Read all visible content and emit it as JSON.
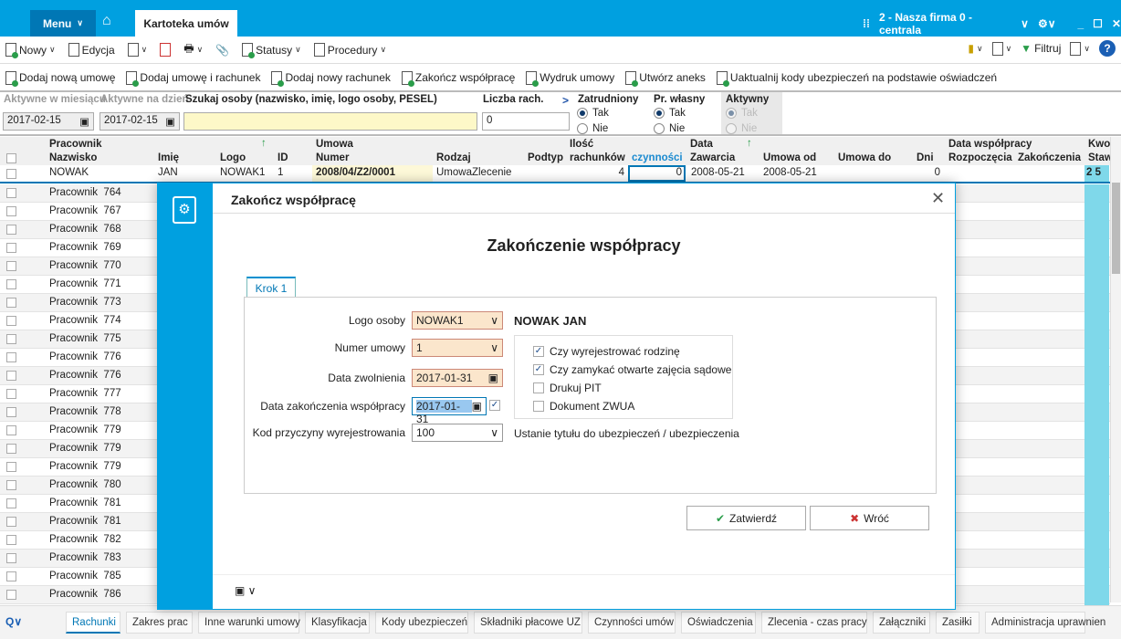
{
  "topbar": {
    "menu": "Menu",
    "tab": "Kartoteka umów",
    "firm": "2 - Nasza firma 0 - centrala"
  },
  "toolbar": {
    "nowy": "Nowy",
    "edycja": "Edycja",
    "statusy": "Statusy",
    "procedury": "Procedury",
    "filtruj": "Filtruj"
  },
  "actions": [
    "Dodaj nową umowę",
    "Dodaj umowę i rachunek",
    "Dodaj nowy rachunek",
    "Zakończ współpracę",
    "Wydruk umowy",
    "Utwórz aneks",
    "Uaktualnij kody ubezpieczeń na podstawie oświadczeń"
  ],
  "filters": {
    "aktywne_miesiac_label": "Aktywne w miesiącu",
    "aktywne_miesiac": "2017-02-15",
    "aktywne_dzien_label": "Aktywne na dzień",
    "aktywne_dzien": "2017-02-15",
    "szukaj_label": "Szukaj osoby (nazwisko, imię, logo osoby, PESEL)",
    "szukaj": "",
    "liczba_label": "Liczba rach.",
    "liczba": "0",
    "zatrudniony_label": "Zatrudniony",
    "wlasny_label": "Pr. własny",
    "aktywny_label": "Aktywny",
    "tak": "Tak",
    "nie": "Nie"
  },
  "grid": {
    "groups": {
      "pracownik": "Pracownik",
      "umowa": "Umowa",
      "ilosc": "Ilość",
      "data": "Data",
      "data_wsp": "Data współpracy",
      "kwota": "Kwo"
    },
    "columns": [
      "Nazwisko",
      "Imię",
      "Logo",
      "ID",
      "Numer",
      "Rodzaj",
      "Podtyp",
      "rachunków",
      "czynności",
      "Zawarcia",
      "Umowa od",
      "Umowa do",
      "Dni",
      "Rozpoczęcia",
      "Zakończenia",
      "Staw"
    ],
    "first_row": {
      "nazwisko": "NOWAK",
      "imie": "JAN",
      "logo": "NOWAK1",
      "id": "1",
      "numer": "2008/04/Z2/0001",
      "rodzaj": "UmowaZlecenie",
      "rachunkow": "4",
      "czynnosci": "0",
      "zawarcia": "2008-05-21",
      "umowa_od": "2008-05-21",
      "dni": "0",
      "stawka": "2 5"
    },
    "rows": [
      "Pracownik  764",
      "Pracownik  767",
      "Pracownik  768",
      "Pracownik  769",
      "Pracownik  770",
      "Pracownik  771",
      "Pracownik  773",
      "Pracownik  774",
      "Pracownik  775",
      "Pracownik  776",
      "Pracownik  776",
      "Pracownik  777",
      "Pracownik  778",
      "Pracownik  779",
      "Pracownik  779",
      "Pracownik  779",
      "Pracownik  780",
      "Pracownik  781",
      "Pracownik  781",
      "Pracownik  782",
      "Pracownik  783",
      "Pracownik  785",
      "Pracownik  786"
    ]
  },
  "bottom_tabs": [
    "Rachunki",
    "Zakres prac",
    "Inne warunki umowy",
    "Klasyfikacja",
    "Kody ubezpieczeń",
    "Składniki płacowe UZ",
    "Czynności umów",
    "Oświadczenia",
    "Zlecenia - czas pracy",
    "Załączniki",
    "Zasiłki",
    "Administracja uprawnien"
  ],
  "dialog": {
    "title": "Zakończ współpracę",
    "heading": "Zakończenie współpracy",
    "step": "Krok 1",
    "logo_label": "Logo osoby",
    "logo": "NOWAK1",
    "person": "NOWAK JAN",
    "numer_label": "Numer umowy",
    "numer": "1",
    "zwolnienie_label": "Data zwolnienia",
    "zwolnienie": "2017-01-31",
    "zakonczenie_label": "Data zakończenia współpracy",
    "zakonczenie": "2017-01-31",
    "kod_label": "Kod przyczyny wyrejestrowania",
    "kod": "100",
    "kod_desc": "Ustanie tytułu do ubezpieczeń / ubezpieczenia",
    "checks": [
      {
        "label": "Czy wyrejestrować rodzinę",
        "checked": true
      },
      {
        "label": "Czy zamykać otwarte zajęcia sądowe",
        "checked": true
      },
      {
        "label": "Drukuj PIT",
        "checked": false
      },
      {
        "label": "Dokument ZWUA",
        "checked": false
      }
    ],
    "ok": "Zatwierdź",
    "back": "Wróć"
  },
  "colors": {
    "accent": "#00a0e0",
    "dark": "#0077b5",
    "required": "#fbe6cc",
    "search": "#fdf8c8",
    "cyan": "#7fd8ea"
  }
}
